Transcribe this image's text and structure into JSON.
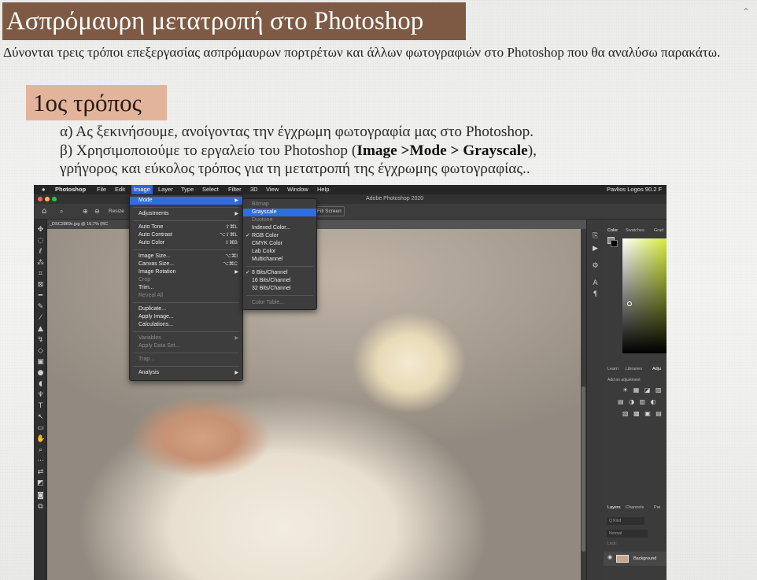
{
  "title": "Ασπρόμαυρη μετατροπή στο Photoshop",
  "intro": "Δύνονται τρεις τρόποι επεξεργασίας ασπρόμαυρων πορτρέτων και άλλων φωτογραφιών στο Photoshop που θα αναλύσω παρακάτω.",
  "section_title": "1ος τρόπος",
  "steps": {
    "a": "α) Ας ξεκινήσουμε,  ανοίγοντας την έγχρωμη φωτογραφία μας στο Photoshop.",
    "b_prefix": "β) Χρησιμοποιούμε το εργαλείο του Photoshop (",
    "b_bold": "Image >Mode > Grayscale",
    "b_suffix": "),",
    "c": "γρήγορος και εύκολος τρόπος για τη μετατροπή της έγχρωμης φωτογραφίας.."
  },
  "nav_icon": "arrow-icon",
  "photoshop": {
    "menubar": {
      "apple": "",
      "items": [
        "Photoshop",
        "File",
        "Edit",
        "Image",
        "Layer",
        "Type",
        "Select",
        "Filter",
        "3D",
        "View",
        "Window",
        "Help"
      ],
      "selected": "Image",
      "user": "Pavlios Logos 90.2 F"
    },
    "window_title": "Adobe Photoshop 2020",
    "options": {
      "resize": "Resize",
      "fill_screen": "Fill Screen"
    },
    "document_tab": "_DSC3869x.jpg @ 16,7% (RC",
    "image_menu": {
      "mode": "Mode",
      "adjustments": "Adjustments",
      "auto_tone": "Auto Tone",
      "auto_tone_sc": "⇧⌘L",
      "auto_contrast": "Auto Contrast",
      "auto_contrast_sc": "⌥⇧⌘L",
      "auto_color": "Auto Color",
      "auto_color_sc": "⇧⌘B",
      "image_size": "Image Size...",
      "image_size_sc": "⌥⌘I",
      "canvas_size": "Canvas Size...",
      "canvas_size_sc": "⌥⌘C",
      "image_rotation": "Image Rotation",
      "crop": "Crop",
      "trim": "Trim...",
      "reveal_all": "Reveal All",
      "duplicate": "Duplicate...",
      "apply_image": "Apply Image...",
      "calculations": "Calculations...",
      "variables": "Variables",
      "apply_data_set": "Apply Data Set...",
      "trap": "Trap...",
      "analysis": "Analysis"
    },
    "mode_menu": {
      "bitmap": "Bitmap",
      "grayscale": "Grayscale",
      "duotone": "Duotone",
      "indexed_color": "Indexed Color...",
      "rgb_color": "RGB Color",
      "cmyk_color": "CMYK Color",
      "lab_color": "Lab Color",
      "multichannel": "Multichannel",
      "bits8": "8 Bits/Channel",
      "bits16": "16 Bits/Channel",
      "bits32": "32 Bits/Channel",
      "color_table": "Color Table..."
    },
    "panels": {
      "color_tabs": [
        "Color",
        "Swatches",
        "Grad"
      ],
      "adjust_tabs": [
        "Learn",
        "Libraries",
        "Adju"
      ],
      "add_adjustment": "Add an adjustment",
      "layers_tabs": [
        "Layers",
        "Channels",
        "Pat"
      ],
      "kind": "Q Kind",
      "blend": "Normal",
      "lock": "Lock:",
      "layer_name": "Background"
    }
  }
}
